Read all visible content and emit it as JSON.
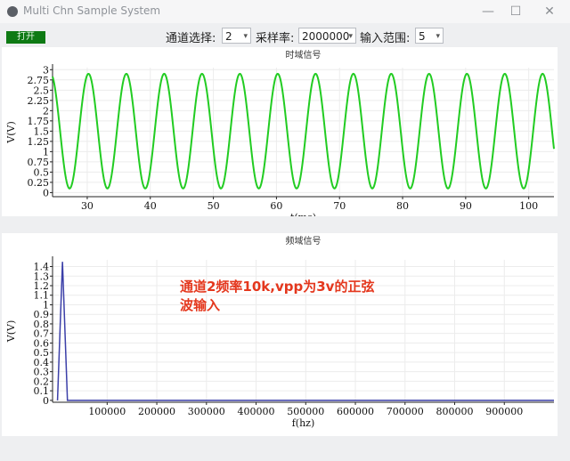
{
  "window": {
    "title": "Multi Chn Sample System",
    "minimize_glyph": "—",
    "maximize_glyph": "☐",
    "close_glyph": "✕"
  },
  "toolbar": {
    "open_label": "打开",
    "channel_label": "通道选择:",
    "channel_value": "2",
    "rate_label": "采样率:",
    "rate_value": "2000000",
    "range_label": "输入范围:",
    "range_value": "5",
    "dropdown_glyph": "▾"
  },
  "annotation": {
    "text": "通道2频率10k,vpp为3v的正弦波输入"
  },
  "chart_data": [
    {
      "type": "line",
      "title": "时域信号",
      "xlabel": "t(ms)",
      "ylabel": "V(V)",
      "xlim": [
        24.5,
        104
      ],
      "ylim": [
        -0.1,
        3.05
      ],
      "xticks": [
        30,
        40,
        50,
        60,
        70,
        80,
        90,
        100
      ],
      "yticks": [
        0,
        0.25,
        0.5,
        0.75,
        1,
        1.25,
        1.5,
        1.75,
        2,
        2.25,
        2.5,
        2.75,
        3
      ],
      "ytick_labels": [
        "0",
        "0.25",
        "0.5",
        "0.75",
        "1",
        "1.25",
        "1.5",
        "1.75",
        "2",
        "2.25",
        "2.5",
        "2.75",
        "3"
      ],
      "color": "#22cc22",
      "grid": true,
      "series": [
        {
          "offset": 1.5,
          "amplitude": 1.4,
          "period": 6,
          "peak_at": 30.2,
          "x_range": [
            24.5,
            104
          ]
        }
      ]
    },
    {
      "type": "line",
      "title": "频域信号",
      "xlabel": "f(hz)",
      "ylabel": "V(V)",
      "xlim": [
        -10000,
        1000000
      ],
      "ylim": [
        -0.02,
        1.47
      ],
      "xticks": [
        100000,
        200000,
        300000,
        400000,
        500000,
        600000,
        700000,
        800000,
        900000
      ],
      "xtick_labels": [
        "100000",
        "200000",
        "300000",
        "400000",
        "500000",
        "600000",
        "700000",
        "800000",
        "900000"
      ],
      "yticks": [
        0,
        0.1,
        0.2,
        0.3,
        0.4,
        0.5,
        0.6,
        0.7,
        0.8,
        0.9,
        1,
        1.1,
        1.2,
        1.3,
        1.4
      ],
      "ytick_labels": [
        "0",
        "0.1",
        "0.2",
        "0.3",
        "0.4",
        "0.5",
        "0.6",
        "0.7",
        "0.8",
        "0.9",
        "1",
        "1.1",
        "1.2",
        "1.3",
        "1.4"
      ],
      "color": "#3b3fa8",
      "grid": true,
      "series": [
        {
          "x": [
            0,
            10000,
            20000,
            1000000
          ],
          "y": [
            0.0,
            1.45,
            0.0,
            0.0
          ]
        }
      ]
    }
  ]
}
